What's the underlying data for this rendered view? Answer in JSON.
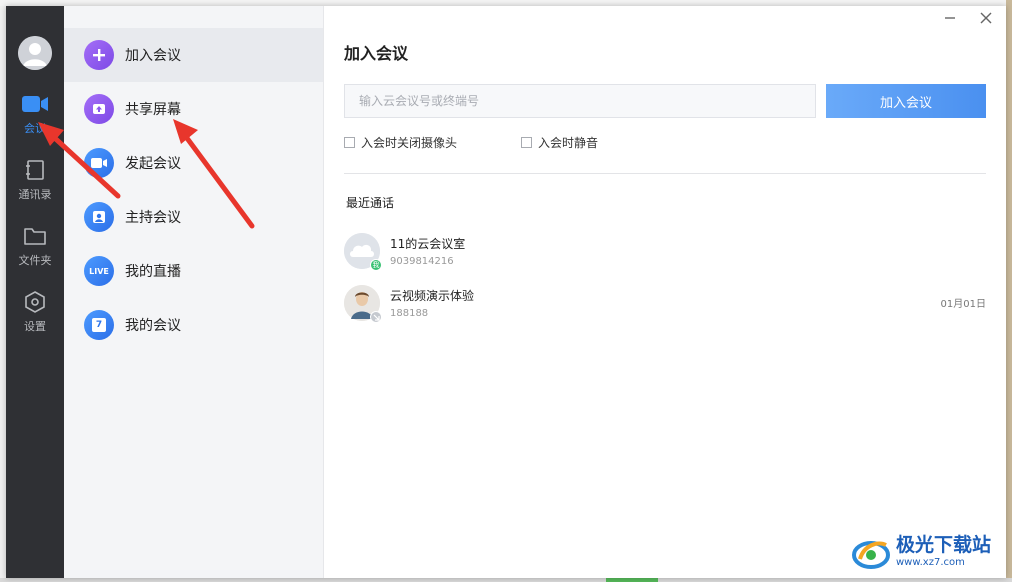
{
  "app": {
    "accent": "#3a8ff5",
    "rail_bg": "#2f3034"
  },
  "rail": {
    "items": [
      {
        "label": "会议",
        "icon": "video-camera-icon",
        "active": true
      },
      {
        "label": "通讯录",
        "icon": "contacts-book-icon",
        "active": false
      },
      {
        "label": "文件夹",
        "icon": "folder-icon",
        "active": false
      },
      {
        "label": "设置",
        "icon": "hexagon-settings-icon",
        "active": false
      }
    ]
  },
  "menu": {
    "items": [
      {
        "label": "加入会议",
        "icon": "plus-circle-icon",
        "active": true
      },
      {
        "label": "共享屏幕",
        "icon": "share-screen-icon",
        "active": false
      },
      {
        "label": "发起会议",
        "icon": "video-camera-icon",
        "active": false
      },
      {
        "label": "主持会议",
        "icon": "host-person-icon",
        "active": false
      },
      {
        "label": "我的直播",
        "icon": "live-icon",
        "live_text": "LIVE",
        "active": false
      },
      {
        "label": "我的会议",
        "icon": "calendar-icon",
        "calendar_day": "7",
        "active": false
      }
    ]
  },
  "main": {
    "title": "加入会议",
    "input_placeholder": "输入云会议号或终端号",
    "join_button": "加入会议",
    "options": [
      {
        "label": "入会时关闭摄像头",
        "checked": false
      },
      {
        "label": "入会时静音",
        "checked": false
      }
    ],
    "recent_title": "最近通话",
    "recent": [
      {
        "name": "11的云会议室",
        "number": "9039814216",
        "date": "",
        "badge": "我",
        "avatar": "cloud-avatar-icon"
      },
      {
        "name": "云视频演示体验",
        "number": "188188",
        "date": "01月01日",
        "badge": "",
        "avatar": "person-photo-avatar"
      }
    ]
  },
  "watermark": {
    "main": "极光下载站",
    "sub": "www.xz7.com"
  }
}
